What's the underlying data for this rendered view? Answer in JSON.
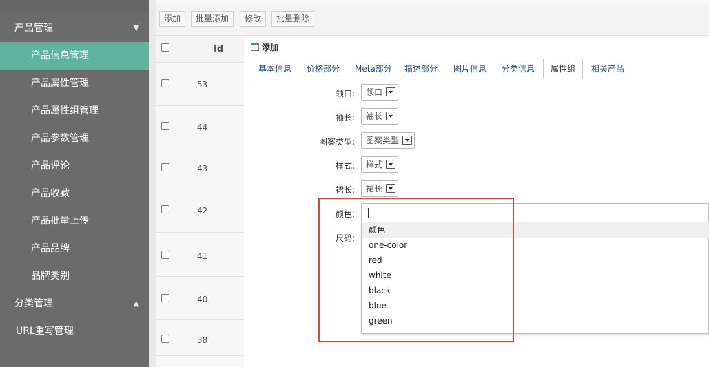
{
  "sidebar": {
    "groups": [
      {
        "label": "产品管理",
        "arrow": "▼"
      },
      {
        "label": "分类管理",
        "arrow": "▲"
      }
    ],
    "items": [
      {
        "label": "产品信息管理",
        "active": true
      },
      {
        "label": "产品属性管理"
      },
      {
        "label": "产品属性组管理"
      },
      {
        "label": "产品参数管理"
      },
      {
        "label": "产品评论"
      },
      {
        "label": "产品收藏"
      },
      {
        "label": "产品批量上传"
      },
      {
        "label": "产品品牌"
      },
      {
        "label": "品牌类别"
      }
    ],
    "url_rewrite": "URL重写管理",
    "active_color": "#5fb3a1"
  },
  "toolbar": {
    "buttons": [
      "添加",
      "批量添加",
      "修改",
      "批量删除"
    ]
  },
  "grid": {
    "id_header": "Id",
    "rows": [
      "53",
      "44",
      "43",
      "42",
      "41",
      "40",
      "38"
    ]
  },
  "panel": {
    "title": "添加",
    "tabs": [
      "基本信息",
      "价格部分",
      "Meta部分",
      "描述部分",
      "图片信息",
      "分类信息",
      "属性组",
      "相关产品"
    ],
    "active_tab": "属性组",
    "fields": [
      {
        "label": "领口:",
        "value": "领口"
      },
      {
        "label": "袖长:",
        "value": "袖长"
      },
      {
        "label": "图案类型:",
        "value": "图案类型"
      },
      {
        "label": "样式:",
        "value": "样式"
      },
      {
        "label": "裙长:",
        "value": "裙长"
      }
    ],
    "color_label": "颜色:",
    "color_value": "",
    "size_label": "尺码:",
    "color_options": [
      "颜色",
      "one-color",
      "red",
      "white",
      "black",
      "blue",
      "green"
    ],
    "highlight_color": "#d9453d"
  }
}
